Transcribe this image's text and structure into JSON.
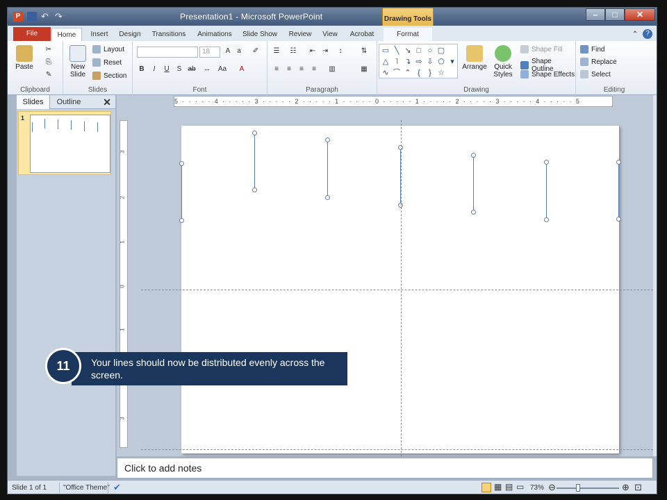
{
  "app": {
    "title": "Presentation1 - Microsoft PowerPoint",
    "contextual_group": "Drawing Tools"
  },
  "window_buttons": {
    "minimize": "–",
    "maximize": "□",
    "close": "✕"
  },
  "tabs": [
    {
      "label": "File"
    },
    {
      "label": "Home"
    },
    {
      "label": "Insert"
    },
    {
      "label": "Design"
    },
    {
      "label": "Transitions"
    },
    {
      "label": "Animations"
    },
    {
      "label": "Slide Show"
    },
    {
      "label": "Review"
    },
    {
      "label": "View"
    },
    {
      "label": "Acrobat"
    },
    {
      "label": "Format"
    }
  ],
  "ribbon": {
    "clipboard": {
      "label": "Clipboard",
      "paste": "Paste"
    },
    "slides": {
      "label": "Slides",
      "new_slide": "New Slide",
      "layout": "Layout",
      "reset": "Reset",
      "section": "Section"
    },
    "font": {
      "label": "Font",
      "size": "18"
    },
    "paragraph": {
      "label": "Paragraph"
    },
    "drawing": {
      "label": "Drawing",
      "arrange": "Arrange",
      "quick_styles": "Quick Styles",
      "shape_fill": "Shape Fill",
      "shape_outline": "Shape Outline",
      "shape_effects": "Shape Effects"
    },
    "editing": {
      "label": "Editing",
      "find": "Find",
      "replace": "Replace",
      "select": "Select"
    }
  },
  "left_pane": {
    "tab_slides": "Slides",
    "tab_outline": "Outline",
    "close": "✕",
    "slide_number": "1"
  },
  "ruler": {
    "h_text": "5 · · · · · 4 · · · · · 3 · · · · · 2 · · · · · 1 · · · · · 0 · · · · · 1 · · · · · 2 · · · · · 3 · · · · · 4 · · · · · 5",
    "v_labels": [
      "3",
      "2",
      "1",
      "0",
      "1",
      "2",
      "3"
    ]
  },
  "callout": {
    "step": "11",
    "text": "Your lines should now be distributed evenly across the screen."
  },
  "notes": {
    "placeholder": "Click to add notes"
  },
  "statusbar": {
    "slide_info": "Slide 1 of 1",
    "theme": "\"Office Theme\"",
    "zoom": "73%"
  },
  "colors": {
    "line": "#4f81bd",
    "callout": "#1b365d",
    "file_tab": "#c43a26"
  }
}
